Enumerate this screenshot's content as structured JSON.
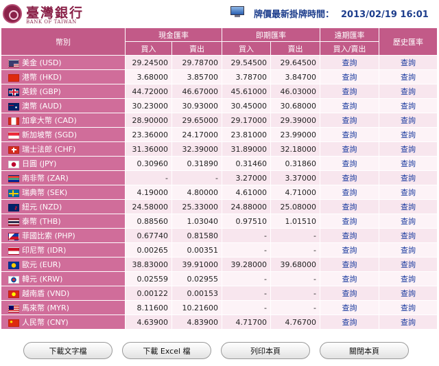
{
  "bank": {
    "name_cn": "臺灣銀行",
    "name_en": "BANK OF TAIWAN"
  },
  "update": {
    "label": "牌價最新掛牌時間：",
    "time": "2013/02/19 16:01"
  },
  "table": {
    "headers": {
      "currency": "幣別",
      "cash": "現金匯率",
      "spot": "即期匯率",
      "forward": "遠期匯率",
      "history": "歷史匯率",
      "buy": "買入",
      "sell": "賣出",
      "buy_sell": "買入/賣出"
    },
    "link_text": "查詢",
    "rows": [
      {
        "currency": "美金 (USD)",
        "flag": "us",
        "cash_buy": "29.24500",
        "cash_sell": "29.78700",
        "spot_buy": "29.54500",
        "spot_sell": "29.64500"
      },
      {
        "currency": "港幣 (HKD)",
        "flag": "hk",
        "cash_buy": "3.68000",
        "cash_sell": "3.85700",
        "spot_buy": "3.78700",
        "spot_sell": "3.84700"
      },
      {
        "currency": "英鎊 (GBP)",
        "flag": "gb",
        "cash_buy": "44.72000",
        "cash_sell": "46.67000",
        "spot_buy": "45.61000",
        "spot_sell": "46.03000"
      },
      {
        "currency": "澳幣 (AUD)",
        "flag": "au",
        "cash_buy": "30.23000",
        "cash_sell": "30.93000",
        "spot_buy": "30.45000",
        "spot_sell": "30.68000"
      },
      {
        "currency": "加拿大幣 (CAD)",
        "flag": "ca",
        "cash_buy": "28.90000",
        "cash_sell": "29.65000",
        "spot_buy": "29.17000",
        "spot_sell": "29.39000"
      },
      {
        "currency": "新加坡幣 (SGD)",
        "flag": "sg",
        "cash_buy": "23.36000",
        "cash_sell": "24.17000",
        "spot_buy": "23.81000",
        "spot_sell": "23.99000"
      },
      {
        "currency": "瑞士法郎 (CHF)",
        "flag": "ch",
        "cash_buy": "31.36000",
        "cash_sell": "32.39000",
        "spot_buy": "31.89000",
        "spot_sell": "32.18000"
      },
      {
        "currency": "日圓 (JPY)",
        "flag": "jp",
        "cash_buy": "0.30960",
        "cash_sell": "0.31890",
        "spot_buy": "0.31460",
        "spot_sell": "0.31860"
      },
      {
        "currency": "南非幣 (ZAR)",
        "flag": "za",
        "cash_buy": "-",
        "cash_sell": "-",
        "spot_buy": "3.27000",
        "spot_sell": "3.37000"
      },
      {
        "currency": "瑞典幣 (SEK)",
        "flag": "se",
        "cash_buy": "4.19000",
        "cash_sell": "4.80000",
        "spot_buy": "4.61000",
        "spot_sell": "4.71000"
      },
      {
        "currency": "紐元 (NZD)",
        "flag": "nz",
        "cash_buy": "24.58000",
        "cash_sell": "25.33000",
        "spot_buy": "24.88000",
        "spot_sell": "25.08000"
      },
      {
        "currency": "泰幣 (THB)",
        "flag": "th",
        "cash_buy": "0.88560",
        "cash_sell": "1.03040",
        "spot_buy": "0.97510",
        "spot_sell": "1.01510"
      },
      {
        "currency": "菲國比索 (PHP)",
        "flag": "ph",
        "cash_buy": "0.67740",
        "cash_sell": "0.81580",
        "spot_buy": "-",
        "spot_sell": "-"
      },
      {
        "currency": "印尼幣 (IDR)",
        "flag": "id",
        "cash_buy": "0.00265",
        "cash_sell": "0.00351",
        "spot_buy": "-",
        "spot_sell": "-"
      },
      {
        "currency": "歐元 (EUR)",
        "flag": "eu",
        "cash_buy": "38.83000",
        "cash_sell": "39.91000",
        "spot_buy": "39.28000",
        "spot_sell": "39.68000"
      },
      {
        "currency": "韓元 (KRW)",
        "flag": "kr",
        "cash_buy": "0.02559",
        "cash_sell": "0.02955",
        "spot_buy": "-",
        "spot_sell": "-"
      },
      {
        "currency": "越南盾 (VND)",
        "flag": "vn",
        "cash_buy": "0.00122",
        "cash_sell": "0.00153",
        "spot_buy": "-",
        "spot_sell": "-"
      },
      {
        "currency": "馬來幣 (MYR)",
        "flag": "my",
        "cash_buy": "8.11600",
        "cash_sell": "10.21600",
        "spot_buy": "-",
        "spot_sell": "-"
      },
      {
        "currency": "人民幣 (CNY)",
        "flag": "cn",
        "cash_buy": "4.63900",
        "cash_sell": "4.83900",
        "spot_buy": "4.71700",
        "spot_sell": "4.76700"
      }
    ]
  },
  "buttons": {
    "download_text": "下載文字檔",
    "download_excel": "下載 Excel 檔",
    "print": "列印本頁",
    "close": "關閉本頁"
  }
}
